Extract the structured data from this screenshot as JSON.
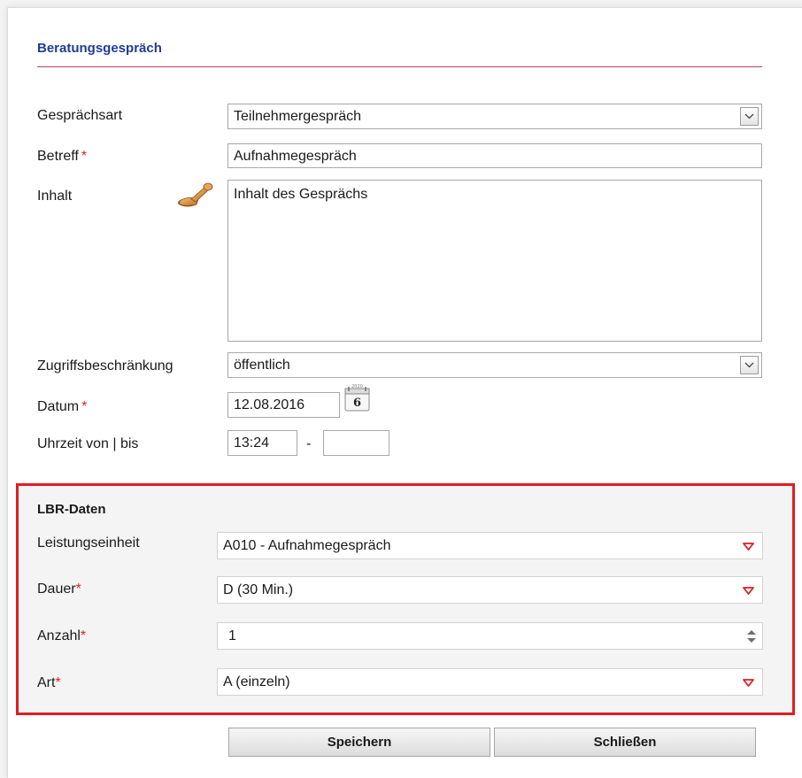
{
  "section": {
    "title": "Beratungsgespräch"
  },
  "form": {
    "gespraechsart": {
      "label": "Gesprächsart",
      "value": "Teilnehmergespräch"
    },
    "betreff": {
      "label": "Betreff",
      "required_mark": "*",
      "value": "Aufnahmegespräch"
    },
    "inhalt": {
      "label": "Inhalt",
      "value": "Inhalt des Gesprächs"
    },
    "zugriff": {
      "label": "Zugriffsbeschränkung",
      "value": "öffentlich"
    },
    "datum": {
      "label": "Datum",
      "required_mark": "*",
      "value": "12.08.2016",
      "calendar_day": "6",
      "calendar_year": "2020"
    },
    "uhrzeit": {
      "label": "Uhrzeit von | bis",
      "from": "13:24",
      "separator": "-",
      "to": ""
    }
  },
  "lbr": {
    "title": "LBR-Daten",
    "leistungseinheit": {
      "label": "Leistungseinheit",
      "value": "A010 - Aufnahmegespräch"
    },
    "dauer": {
      "label": "Dauer",
      "required_mark": "*",
      "value": "D (30 Min.)"
    },
    "anzahl": {
      "label": "Anzahl",
      "required_mark": "*",
      "value": "1"
    },
    "art": {
      "label": "Art",
      "required_mark": "*",
      "value": "A (einzeln)"
    }
  },
  "buttons": {
    "save": "Speichern",
    "close": "Schließen"
  },
  "colors": {
    "title": "#1f3c99",
    "title_rule": "#b3485e",
    "required": "#e0202a",
    "highlight_border": "#e31b23",
    "dropdown_triangle": "#e31b23"
  },
  "icons": {
    "inhalt_icon": "stamp-icon",
    "datum_icon": "calendar-icon",
    "select_arrow": "chevron-down-icon",
    "lbr_select_arrow": "triangle-down-icon",
    "anzahl_spinner": "spinner-icon"
  }
}
